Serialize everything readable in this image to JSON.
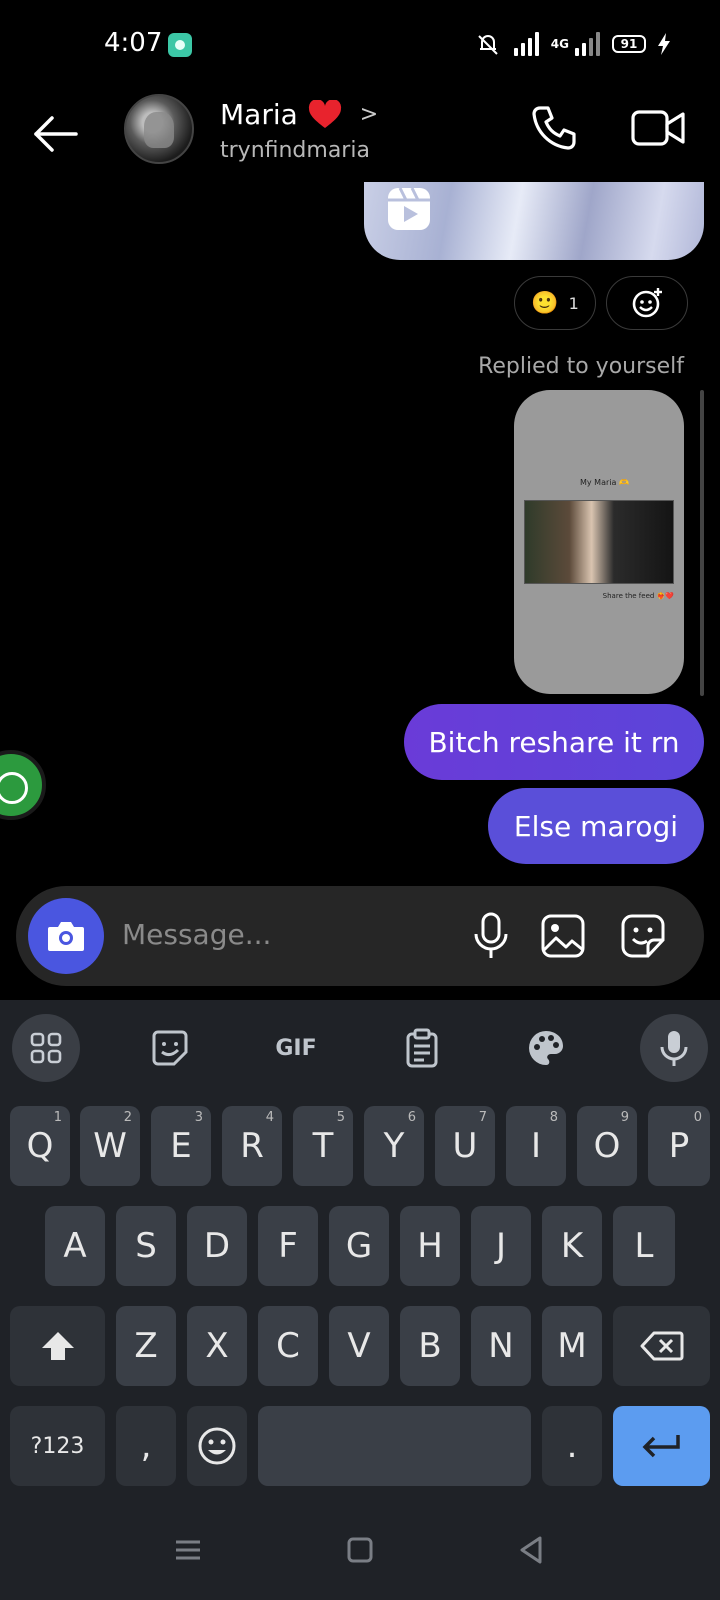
{
  "status_bar": {
    "time": "4:07",
    "network": "4G",
    "battery": "91"
  },
  "header": {
    "name": "Maria",
    "chevron": ">",
    "username": "trynfindmaria"
  },
  "messages": {
    "reaction_emoji": "🙂",
    "reaction_count": "1",
    "replied_label": "Replied to yourself",
    "reply_card_caption": "My Maria 🫶",
    "reply_card_footer": "Share the feed ❤️‍🔥❤️",
    "bubble_1": "Bitch reshare it rn",
    "bubble_2": "Else marogi"
  },
  "composer": {
    "placeholder": "Message..."
  },
  "keyboard": {
    "toolbar": {
      "gif_label": "GIF"
    },
    "row1": [
      {
        "k": "Q",
        "h": "1"
      },
      {
        "k": "W",
        "h": "2"
      },
      {
        "k": "E",
        "h": "3"
      },
      {
        "k": "R",
        "h": "4"
      },
      {
        "k": "T",
        "h": "5"
      },
      {
        "k": "Y",
        "h": "6"
      },
      {
        "k": "U",
        "h": "7"
      },
      {
        "k": "I",
        "h": "8"
      },
      {
        "k": "O",
        "h": "9"
      },
      {
        "k": "P",
        "h": "0"
      }
    ],
    "row2": [
      "A",
      "S",
      "D",
      "F",
      "G",
      "H",
      "J",
      "K",
      "L"
    ],
    "row3": [
      "Z",
      "X",
      "C",
      "V",
      "B",
      "N",
      "M"
    ],
    "symbols_label": "?123",
    "comma": ",",
    "period": "."
  },
  "colors": {
    "accent": "#5a4fd9",
    "camera_button": "#4a56e0",
    "enter_key": "#5c9cf0"
  }
}
